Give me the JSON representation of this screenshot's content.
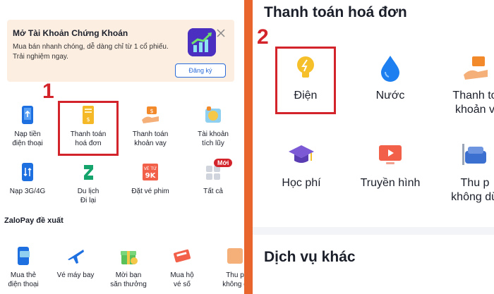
{
  "left": {
    "promo": {
      "title": "Mở Tài Khoản Chứng Khoán",
      "desc": "Mua bán nhanh chóng, dễ dàng chỉ từ 1 cổ phiếu. Trải nghiệm ngay.",
      "button": "Đăng ký"
    },
    "marker": "1",
    "grid": [
      {
        "label1": "Nạp tiền",
        "label2": "điện thoại",
        "icon": "phone-topup-icon"
      },
      {
        "label1": "Thanh toán",
        "label2": "hoá đơn",
        "icon": "bill-icon"
      },
      {
        "label1": "Thanh toán",
        "label2": "khoản vay",
        "icon": "loan-icon"
      },
      {
        "label1": "Tài khoản",
        "label2": "tích lũy",
        "icon": "savings-icon"
      },
      {
        "label1": "Nạp 3G/4G",
        "label2": "",
        "icon": "data-topup-icon"
      },
      {
        "label1": "Du lịch",
        "label2": "Đi lại",
        "icon": "travel-icon"
      },
      {
        "label1": "Đặt vé phim",
        "label2": "",
        "icon": "movie-ticket-icon",
        "badge": "VÉ TỪ 9K"
      },
      {
        "label1": "Tất cả",
        "label2": "",
        "icon": "all-services-icon",
        "badge": "Mới"
      }
    ],
    "section_title": "ZaloPay đề xuất",
    "suggest": [
      {
        "label1": "Mua thẻ",
        "label2": "điện thoại",
        "icon": "phone-card-icon"
      },
      {
        "label1": "Vé máy bay",
        "label2": "",
        "icon": "airplane-icon"
      },
      {
        "label1": "Mời bạn",
        "label2": "săn thưởng",
        "icon": "gift-icon"
      },
      {
        "label1": "Mua hộ",
        "label2": "vé số",
        "icon": "lottery-icon"
      },
      {
        "label1": "Thu p",
        "label2": "không d",
        "icon": "fee-icon"
      }
    ]
  },
  "right": {
    "title": "Thanh toán hoá đơn",
    "marker": "2",
    "items": [
      {
        "label1": "Điện",
        "label2": "",
        "icon": "lightbulb-icon"
      },
      {
        "label1": "Nước",
        "label2": "",
        "icon": "water-drop-icon"
      },
      {
        "label1": "Thanh to",
        "label2": "khoản v",
        "icon": "loan-icon"
      },
      {
        "label1": "Học phí",
        "label2": "",
        "icon": "graduation-cap-icon"
      },
      {
        "label1": "Truyền hình",
        "label2": "",
        "icon": "tv-icon"
      },
      {
        "label1": "Thu p",
        "label2": "không dừ",
        "icon": "toll-icon"
      }
    ],
    "other_title": "Dịch vụ khác"
  },
  "colors": {
    "accent": "#d4242b",
    "divider": "#e8662d",
    "brand_blue": "#2a6bd9"
  }
}
